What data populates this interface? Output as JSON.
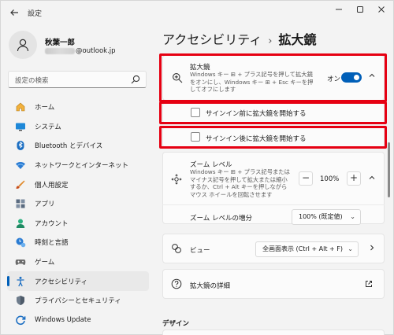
{
  "window": {
    "title": "設定"
  },
  "profile": {
    "name": "秋葉一郎",
    "email_suffix": "@outlook.jp"
  },
  "search": {
    "placeholder": "設定の検索"
  },
  "nav": [
    {
      "label": "ホーム",
      "icon": "home-icon"
    },
    {
      "label": "システム",
      "icon": "system-icon"
    },
    {
      "label": "Bluetooth とデバイス",
      "icon": "bluetooth-icon"
    },
    {
      "label": "ネットワークとインターネット",
      "icon": "network-icon"
    },
    {
      "label": "個人用設定",
      "icon": "personalization-icon"
    },
    {
      "label": "アプリ",
      "icon": "apps-icon"
    },
    {
      "label": "アカウント",
      "icon": "account-icon"
    },
    {
      "label": "時刻と言語",
      "icon": "time-language-icon"
    },
    {
      "label": "ゲーム",
      "icon": "gaming-icon"
    },
    {
      "label": "アクセシビリティ",
      "icon": "accessibility-icon",
      "active": true
    },
    {
      "label": "プライバシーとセキュリティ",
      "icon": "privacy-icon"
    },
    {
      "label": "Windows Update",
      "icon": "windows-update-icon"
    }
  ],
  "breadcrumb": {
    "parent": "アクセシビリティ",
    "separator": "›",
    "current": "拡大鏡"
  },
  "magnifier": {
    "title": "拡大鏡",
    "description": "Windows キー ⊞ + プラス記号を押して拡大鏡をオンにし、Windows キー ⊞ + Esc キーを押してオフにします",
    "toggle_label": "オン",
    "toggle_on": true
  },
  "checkbox_before_signin": {
    "label": "サインイン前に拡大鏡を開始する",
    "checked": false
  },
  "checkbox_after_signin": {
    "label": "サインイン後に拡大鏡を開始する",
    "checked": false
  },
  "zoom": {
    "title": "ズーム レベル",
    "description": "Windows キー ⊞ + プラス記号またはマイナス記号を押して拡大または縮小するか、Ctrl + Alt キーを押しながらマウス ホイールを回転させます",
    "minus": "−",
    "plus": "+",
    "value": "100%"
  },
  "zoom_increment": {
    "label": "ズーム レベルの増分",
    "value": "100% (既定値)"
  },
  "view": {
    "label": "ビュー",
    "value": "全画面表示 (Ctrl + Alt + F)"
  },
  "details": {
    "label": "拡大鏡の詳細"
  },
  "design_section": {
    "label": "デザイン"
  },
  "colors": {
    "accent": "#005fb8",
    "highlight": "#e60012"
  }
}
